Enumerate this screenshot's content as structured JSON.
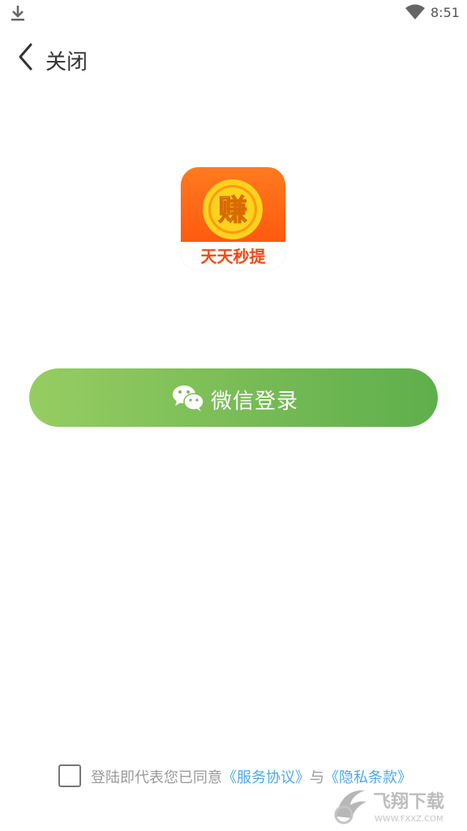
{
  "status_bar": {
    "time": "8:51",
    "download_icon": "download-icon",
    "wifi_icon": "wifi-icon"
  },
  "header": {
    "back_icon": "chevron-left-icon",
    "close_label": "关闭"
  },
  "app_logo": {
    "coin_char": "赚",
    "name": "天天秒提"
  },
  "login_button": {
    "icon": "wechat-icon",
    "label": "微信登录",
    "color_start": "#96cd62",
    "color_end": "#5eaf4c"
  },
  "agreement": {
    "checked": false,
    "prefix": "登陆即代表您已同意",
    "service_link": "《服务协议》",
    "connector": "与",
    "privacy_link": "《隐私条款》",
    "link_color": "#4fa8e8"
  },
  "watermark": {
    "text": "飞翔下载",
    "site": "WWW.FXXZ.COM"
  }
}
